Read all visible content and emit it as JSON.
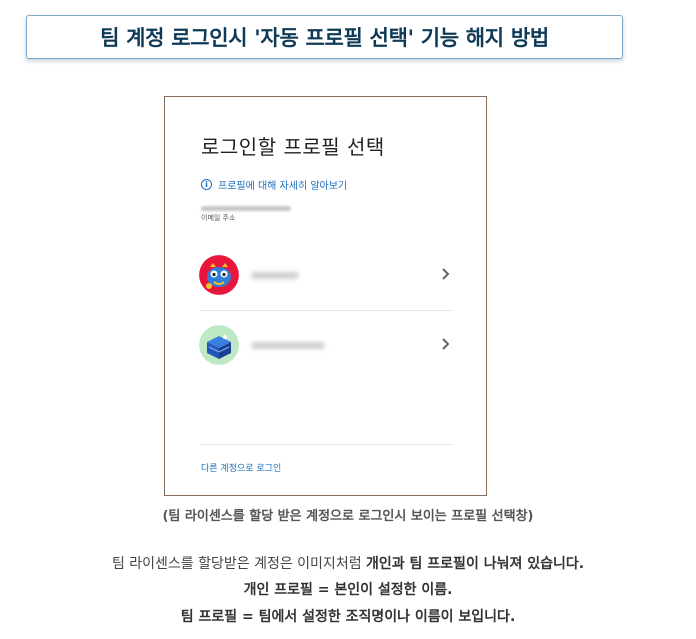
{
  "title": "팀 계정 로그인시 '자동 프로필 선택' 기능 해지 방법",
  "screenshot": {
    "heading": "로그인할 프로필 선택",
    "learn_more": "프로필에 대해 자세히 알아보기",
    "info_icon_glyph": "i",
    "email_label": "이메일 주소",
    "profiles": [
      {
        "avatar": "red-monster-avatar",
        "name": "blurred"
      },
      {
        "avatar": "blue-cube-avatar",
        "name": "blurred"
      }
    ],
    "other_login": "다른 계정으로 로그인"
  },
  "caption": "(팀 라이센스를 할당 받은 계정으로 로그인시 보이는 프로필 선택창)",
  "body": {
    "line1_normal": "팀 라이센스를 할당받은 계정은 이미지처럼 ",
    "line1_bold": "개인과 팀 프로필이 나눠져 있습니다.",
    "line2": "개인 프로필 = 본인이 설정한 이름.",
    "line3": "팀 프로필 =  팀에서 설정한 조직명이나 이름이 보입니다."
  },
  "colors": {
    "title_text": "#0f3a57",
    "link": "#1a6fbf",
    "title_border": "#7fa9c8"
  }
}
